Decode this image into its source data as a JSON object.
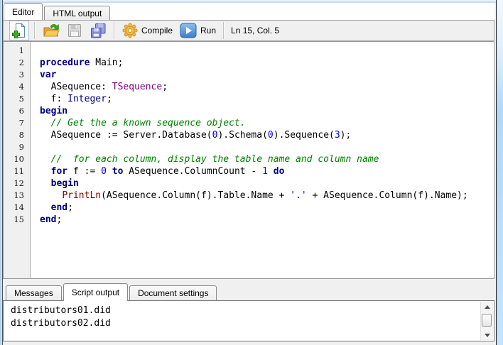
{
  "top_tabs": [
    {
      "label": "Editor",
      "active": true
    },
    {
      "label": "HTML output",
      "active": false
    }
  ],
  "toolbar": {
    "buttons": [
      {
        "name": "new-script",
        "icon": "new-file-icon"
      },
      {
        "name": "open",
        "icon": "open-folder-icon"
      },
      {
        "name": "save",
        "icon": "save-icon",
        "disabled": true
      },
      {
        "name": "save-all",
        "icon": "save-all-icon"
      },
      {
        "name": "compile",
        "icon": "gear-icon",
        "label": "Compile"
      },
      {
        "name": "run",
        "icon": "run-icon",
        "label": "Run"
      }
    ],
    "status": "Ln 15, Col. 5"
  },
  "editor": {
    "line_numbers": [
      "1",
      "2",
      "3",
      "4",
      "5",
      "6",
      "7",
      "8",
      "9",
      "10",
      "11",
      "12",
      "13",
      "14",
      "15"
    ],
    "code_lines": [
      [],
      [
        {
          "t": "procedure",
          "c": "kw"
        },
        {
          "t": " Main;",
          "c": "id"
        }
      ],
      [
        {
          "t": "var",
          "c": "kw"
        }
      ],
      [
        {
          "t": "  ASequence: ",
          "c": "id"
        },
        {
          "t": "TSequence",
          "c": "type"
        },
        {
          "t": ";",
          "c": "id"
        }
      ],
      [
        {
          "t": "  f: ",
          "c": "id"
        },
        {
          "t": "Integer",
          "c": "builtin"
        },
        {
          "t": ";",
          "c": "id"
        }
      ],
      [
        {
          "t": "begin",
          "c": "kw"
        }
      ],
      [
        {
          "t": "  ",
          "c": "id"
        },
        {
          "t": "// Get the a known sequence object.",
          "c": "comment"
        }
      ],
      [
        {
          "t": "  ASequence := Server.Database(",
          "c": "id"
        },
        {
          "t": "0",
          "c": "num"
        },
        {
          "t": ").Schema(",
          "c": "id"
        },
        {
          "t": "0",
          "c": "num"
        },
        {
          "t": ").Sequence(",
          "c": "id"
        },
        {
          "t": "3",
          "c": "num"
        },
        {
          "t": ");",
          "c": "id"
        }
      ],
      [],
      [
        {
          "t": "  ",
          "c": "id"
        },
        {
          "t": "//  for each column, display the table name and column name",
          "c": "comment"
        }
      ],
      [
        {
          "t": "  ",
          "c": "id"
        },
        {
          "t": "for",
          "c": "kw"
        },
        {
          "t": " f := ",
          "c": "id"
        },
        {
          "t": "0",
          "c": "num"
        },
        {
          "t": " ",
          "c": "id"
        },
        {
          "t": "to",
          "c": "kw"
        },
        {
          "t": " ASequence.ColumnCount - ",
          "c": "id"
        },
        {
          "t": "1",
          "c": "num"
        },
        {
          "t": " ",
          "c": "id"
        },
        {
          "t": "do",
          "c": "kw"
        }
      ],
      [
        {
          "t": "  ",
          "c": "id"
        },
        {
          "t": "begin",
          "c": "kw"
        }
      ],
      [
        {
          "t": "    ",
          "c": "id"
        },
        {
          "t": "PrintLn",
          "c": "func"
        },
        {
          "t": "(ASequence.Column(f).Table.Name + ",
          "c": "id"
        },
        {
          "t": "'.'",
          "c": "str"
        },
        {
          "t": " + ASequence.Column(f).Name);",
          "c": "id"
        }
      ],
      [
        {
          "t": "  ",
          "c": "id"
        },
        {
          "t": "end",
          "c": "kw"
        },
        {
          "t": ";",
          "c": "id"
        }
      ],
      [
        {
          "t": "end",
          "c": "kw"
        },
        {
          "t": ";",
          "c": "id"
        }
      ]
    ]
  },
  "syntax_colors": {
    "kw": "#000080",
    "id": "#000000",
    "type": "#800080",
    "builtin": "#000080",
    "num": "#0000ff",
    "str": "#0000ff",
    "comment": "#008000",
    "func": "#800000"
  },
  "bottom_tabs": [
    {
      "label": "Messages",
      "active": false
    },
    {
      "label": "Script output",
      "active": true
    },
    {
      "label": "Document settings",
      "active": false
    }
  ],
  "output": {
    "lines": [
      "distributors01.did",
      "distributors02.did"
    ]
  },
  "ui_colors": {
    "window_border": "#b9d7f2",
    "panel_bg": "#f0f0f0",
    "gutter_bg": "#f0f0f0"
  }
}
